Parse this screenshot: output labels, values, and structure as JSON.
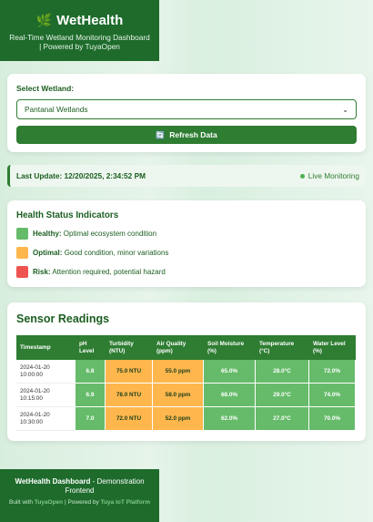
{
  "header": {
    "logo_icon": "leaf-icon",
    "logo_glyph": "🌿",
    "title": "WetHealth",
    "tagline": "Real-Time Wetland Monitoring Dashboard | Powered by TuyaOpen"
  },
  "selector": {
    "label": "Select Wetland:",
    "selected": "Pantanal Wetlands",
    "arrow": "⌄",
    "refresh_icon": "refresh-icon",
    "refresh_glyph": "🔄",
    "refresh_label": "Refresh Data"
  },
  "status": {
    "last_update": "Last Update: 12/20/2025, 2:34:52 PM",
    "live_label": "Live Monitoring"
  },
  "health": {
    "title": "Health Status Indicators",
    "items": [
      {
        "name": "Healthy:",
        "desc": "Optimal ecosystem condition",
        "color": "#66bb6a"
      },
      {
        "name": "Optimal:",
        "desc": "Good condition, minor variations",
        "color": "#ffb74d"
      },
      {
        "name": "Risk:",
        "desc": "Attention required, potential hazard",
        "color": "#ef5350"
      }
    ]
  },
  "sensors": {
    "title": "Sensor Readings",
    "columns": [
      "Timestamp",
      "pH Level",
      "Turbidity (NTU)",
      "Air Quality (ppm)",
      "Soil Moisture (%)",
      "Temperature (°C)",
      "Water Level (%)"
    ],
    "rows": [
      {
        "ts": "2024-01-20 10:00:00",
        "cells": [
          {
            "v": "6.8",
            "s": "healthy"
          },
          {
            "v": "75.0 NTU",
            "s": "optimal"
          },
          {
            "v": "55.0 ppm",
            "s": "optimal"
          },
          {
            "v": "65.0%",
            "s": "healthy"
          },
          {
            "v": "28.0°C",
            "s": "healthy"
          },
          {
            "v": "72.0%",
            "s": "healthy"
          }
        ]
      },
      {
        "ts": "2024-01-20 10:15:00",
        "cells": [
          {
            "v": "6.9",
            "s": "healthy"
          },
          {
            "v": "78.0 NTU",
            "s": "optimal"
          },
          {
            "v": "58.0 ppm",
            "s": "optimal"
          },
          {
            "v": "68.0%",
            "s": "healthy"
          },
          {
            "v": "29.0°C",
            "s": "healthy"
          },
          {
            "v": "74.0%",
            "s": "healthy"
          }
        ]
      },
      {
        "ts": "2024-01-20 10:30:00",
        "cells": [
          {
            "v": "7.0",
            "s": "healthy"
          },
          {
            "v": "72.0 NTU",
            "s": "optimal"
          },
          {
            "v": "52.0 ppm",
            "s": "optimal"
          },
          {
            "v": "62.0%",
            "s": "healthy"
          },
          {
            "v": "27.0°C",
            "s": "healthy"
          },
          {
            "v": "70.0%",
            "s": "healthy"
          }
        ]
      }
    ],
    "status_colors": {
      "healthy": "#66bb6a",
      "optimal": "#ffb74d",
      "risk": "#ef5350"
    }
  },
  "footer": {
    "title": "WetHealth Dashboard",
    "title_suffix": " - Demonstration Frontend",
    "built_prefix": "Built with ",
    "built_link": "TuyaOpen",
    "powered_prefix": " | Powered by ",
    "powered_link": "Tuya IoT Platform"
  }
}
